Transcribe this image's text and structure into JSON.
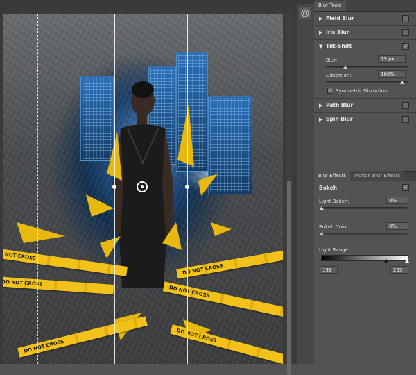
{
  "panel": {
    "blur_tools_tab": "Blur Tools",
    "sections": [
      {
        "label": "Field Blur",
        "expanded": false,
        "checked": false
      },
      {
        "label": "Iris Blur",
        "expanded": false,
        "checked": false
      },
      {
        "label": "Tilt-Shift",
        "expanded": true,
        "checked": true
      },
      {
        "label": "Path Blur",
        "expanded": false,
        "checked": false
      },
      {
        "label": "Spin Blur",
        "expanded": false,
        "checked": false
      }
    ],
    "tilt_shift": {
      "blur_label": "Blur:",
      "blur_value": "15 px",
      "blur_level": 0.15,
      "distortion_label": "Distortion:",
      "distortion_value": "100%",
      "distortion_level": 1.0,
      "symmetric_label": "Symmetric Distortion",
      "symmetric_checked": true
    }
  },
  "effects": {
    "tab_blur_effects": "Blur Effects",
    "tab_motion_blur_effects": "Motion Blur Effects",
    "bokeh_label": "Bokeh",
    "bokeh_checked": true,
    "light_bokeh_label": "Light Bokeh:",
    "light_bokeh_value": "0%",
    "bokeh_color_label": "Bokeh Color:",
    "bokeh_color_value": "0%",
    "light_range_label": "Light Range:",
    "light_range_min": "191",
    "light_range_max": "255"
  },
  "canvas": {
    "tape_text": "DO NOT CROSS"
  },
  "icons": {
    "triangle_collapsed": "▶",
    "triangle_expanded": "▼",
    "check": "✓"
  },
  "colors": {
    "panel_bg": "#535353",
    "tape_yellow": "#f2c21b",
    "city_blue": "#2c6fb8"
  }
}
